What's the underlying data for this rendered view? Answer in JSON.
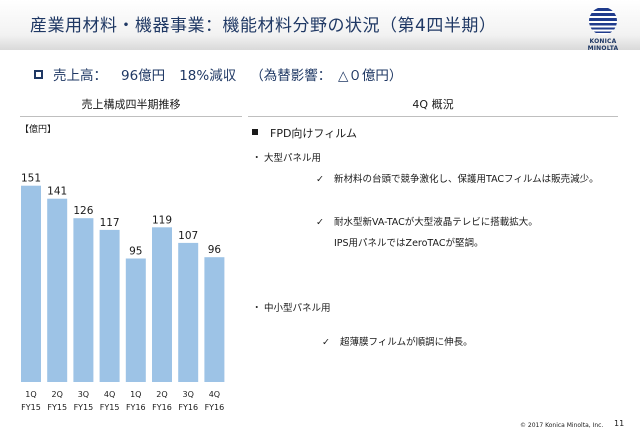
{
  "header": {
    "title": "産業用材料・機器事業：機能材料分野の状況（第4四半期）",
    "logo_text": "KONICA MINOLTA"
  },
  "summary": {
    "label": "売上高：",
    "revenue": "96億円",
    "change": "18%減収",
    "fx": "（為替影響：　△０億円）"
  },
  "left_section_title": "売上構成四半期推移",
  "right_section_title": "4Q 概況",
  "chart_data": {
    "type": "bar",
    "unit_label": "【億円】",
    "categories": [
      [
        "1Q",
        "FY15"
      ],
      [
        "2Q",
        "FY15"
      ],
      [
        "3Q",
        "FY15"
      ],
      [
        "4Q",
        "FY15"
      ],
      [
        "1Q",
        "FY16"
      ],
      [
        "2Q",
        "FY16"
      ],
      [
        "3Q",
        "FY16"
      ],
      [
        "4Q",
        "FY16"
      ]
    ],
    "values": [
      151,
      141,
      126,
      117,
      95,
      119,
      107,
      96
    ],
    "bar_color": "#9dc3e6",
    "ylim": [
      0,
      160
    ],
    "grid": false
  },
  "overview": {
    "heading": "FPD向けフィルム",
    "large_panel": {
      "label": "大型パネル用",
      "point1": "新材料の台頭で競争激化し、保護用TACフィルムは販売減少。",
      "point2": "耐水型新VA-TACが大型液晶テレビに搭載拡大。",
      "point2_note": "IPS用パネルではZeroTACが堅調。"
    },
    "small_panel": {
      "label": "中小型パネル用",
      "point1": "超薄膜フィルムが順調に伸長。"
    }
  },
  "footer": {
    "copyright": "© 2017 Konica Minolta, Inc.",
    "page": "11"
  }
}
